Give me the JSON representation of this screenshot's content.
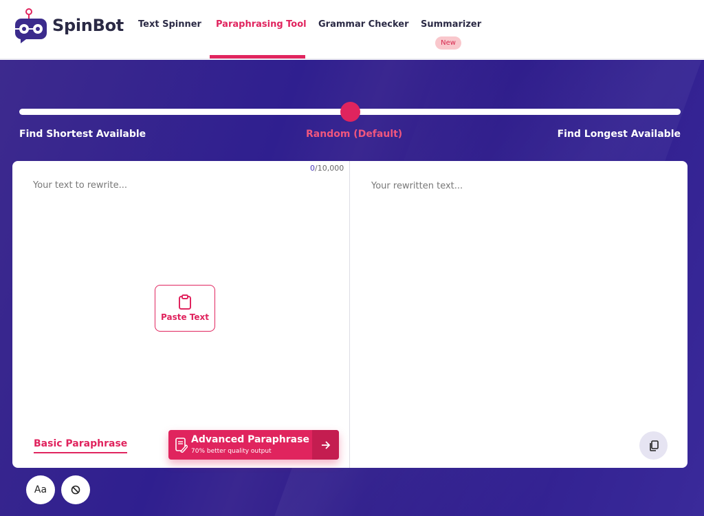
{
  "app": {
    "name": "SpinBot"
  },
  "nav": {
    "items": [
      {
        "label": "Text Spinner"
      },
      {
        "label": "Paraphrasing Tool",
        "active": true
      },
      {
        "label": "Grammar Checker"
      },
      {
        "label": "Summarizer",
        "badge": "New"
      }
    ]
  },
  "slider": {
    "left_label": "Find Shortest Available",
    "middle_label": "Random (Default)",
    "right_label": "Find Longest Available",
    "position": 0.5
  },
  "editor": {
    "counter_current": "0",
    "counter_max": "/10,000",
    "input_placeholder": "Your text to rewrite...",
    "output_placeholder": "Your rewritten text...",
    "paste_label": "Paste Text",
    "basic_tab": "Basic Paraphrase",
    "advanced_title": "Advanced Paraphrase",
    "advanced_subtitle": "70% better quality output"
  },
  "toolbar": {
    "font_button": "Aa"
  },
  "colors": {
    "accent": "#e0245e",
    "hero": "#2f1f8f",
    "dark": "#2b2a45"
  },
  "icons": [
    "robot-logo-icon",
    "clipboard-icon",
    "pencil-doc-icon",
    "arrow-right-icon",
    "copy-icon",
    "block-icon"
  ]
}
